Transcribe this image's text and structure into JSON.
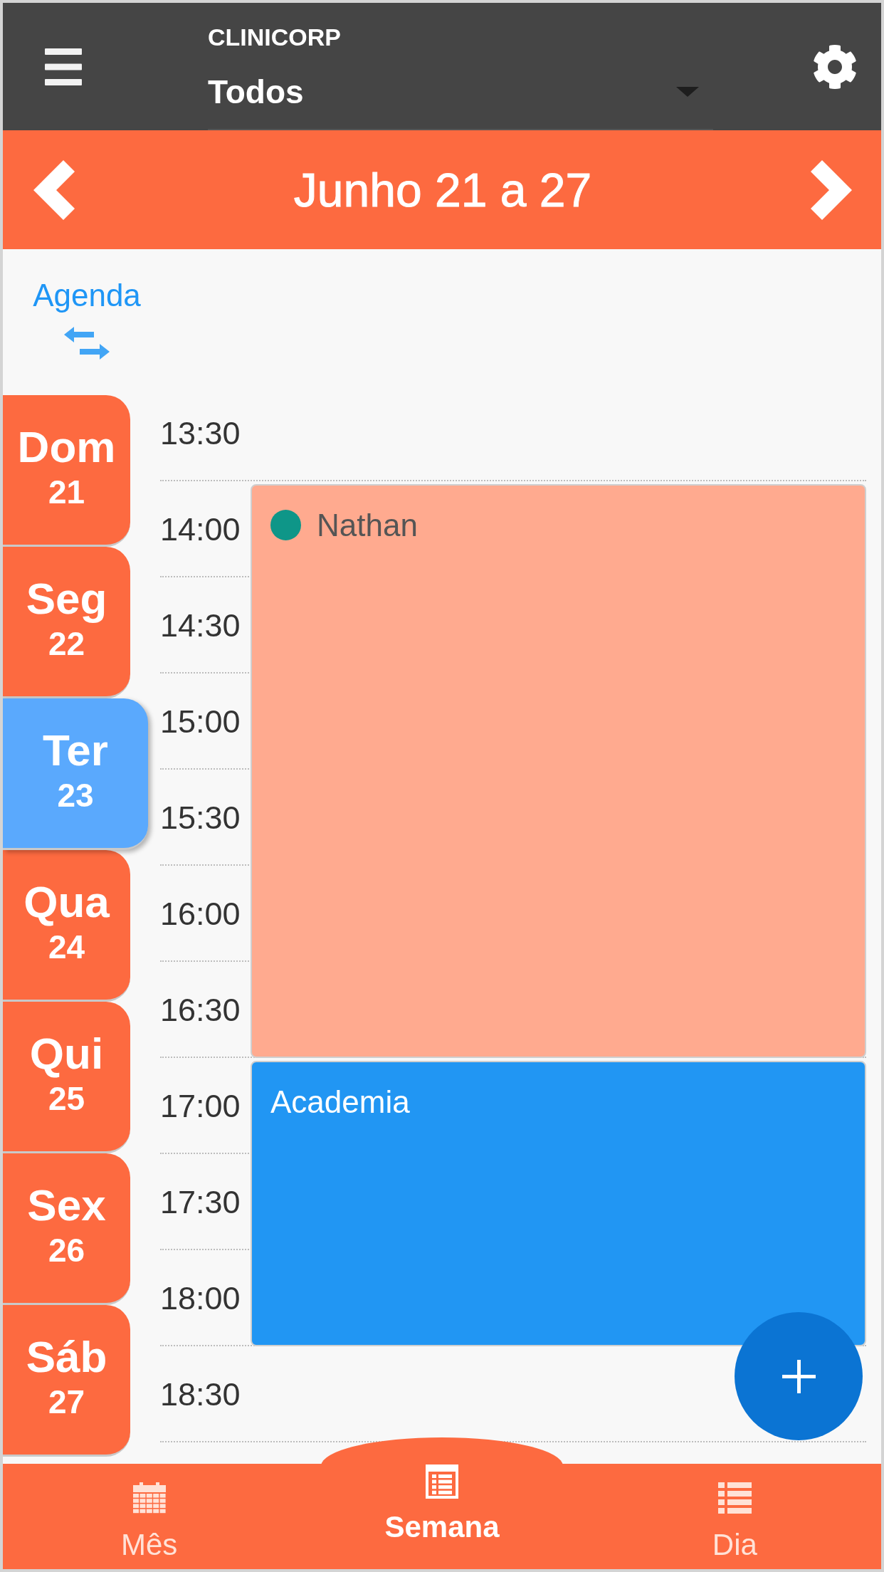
{
  "header": {
    "select_label": "CLINICORP",
    "select_value": "Todos"
  },
  "week_bar": {
    "title": "Junho 21 a 27"
  },
  "agenda_toggle": {
    "label": "Agenda"
  },
  "days": [
    {
      "name": "Dom",
      "number": "21",
      "selected": false
    },
    {
      "name": "Seg",
      "number": "22",
      "selected": false
    },
    {
      "name": "Ter",
      "number": "23",
      "selected": true
    },
    {
      "name": "Qua",
      "number": "24",
      "selected": false
    },
    {
      "name": "Qui",
      "number": "25",
      "selected": false
    },
    {
      "name": "Sex",
      "number": "26",
      "selected": false
    },
    {
      "name": "Sáb",
      "number": "27",
      "selected": false
    }
  ],
  "timeline": [
    {
      "time": "13:30"
    },
    {
      "time": "14:00",
      "event": {
        "title": "Nathan",
        "color": "#ffaa8f",
        "status": {
          "color": "#0e9688"
        }
      }
    },
    {
      "time": "14:30"
    },
    {
      "time": "15:00"
    },
    {
      "time": "15:30"
    },
    {
      "time": "16:00"
    },
    {
      "time": "16:30"
    },
    {
      "time": "17:00",
      "event": {
        "title": "Academia",
        "color": "#2196f3"
      }
    },
    {
      "time": "17:30"
    },
    {
      "time": "18:00"
    },
    {
      "time": "18:30"
    }
  ],
  "bottom_nav": [
    {
      "kind": "month",
      "label": "Mês",
      "selected": false
    },
    {
      "kind": "week",
      "label": "Semana",
      "selected": true
    },
    {
      "kind": "day",
      "label": "Dia",
      "selected": false
    }
  ]
}
